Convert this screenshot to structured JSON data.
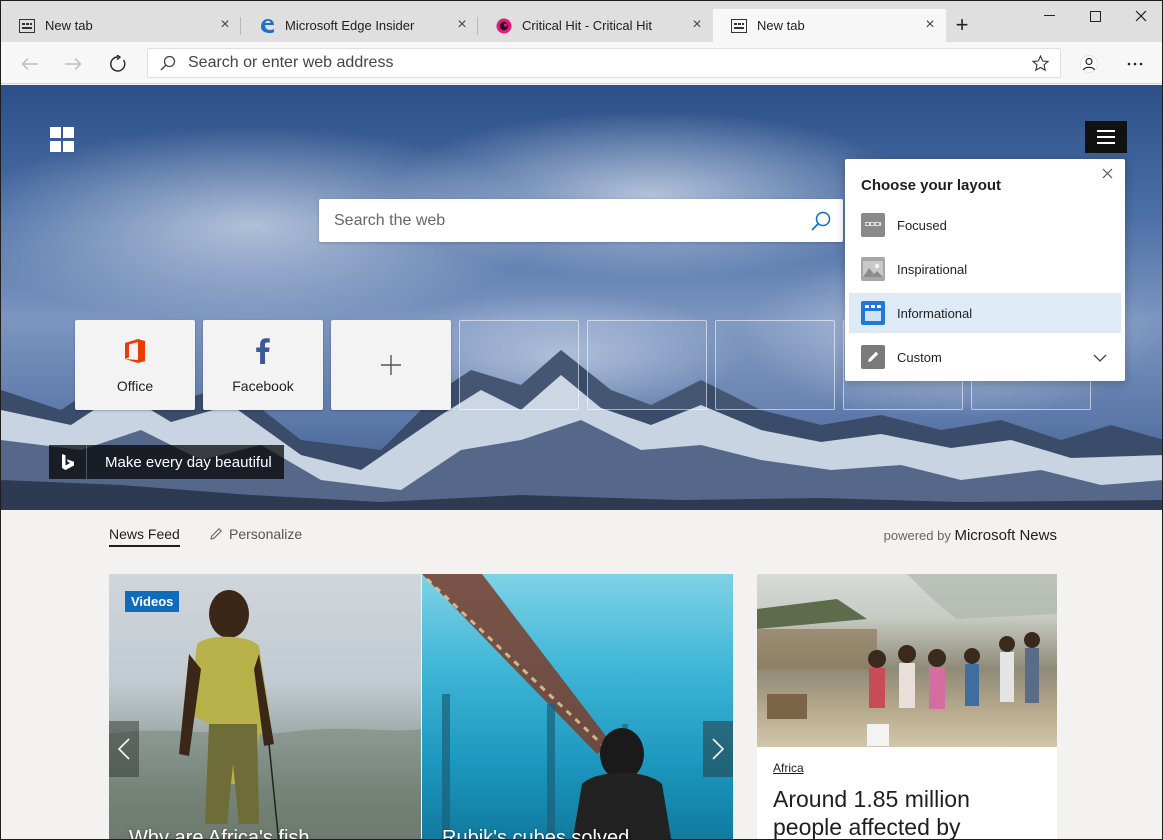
{
  "tabs": [
    {
      "title": "New tab",
      "icon": "newtab-icon"
    },
    {
      "title": "Microsoft Edge Insider",
      "icon": "edge-icon"
    },
    {
      "title": "Critical Hit - Critical Hit",
      "icon": "criticalhit-icon"
    },
    {
      "title": "New tab",
      "icon": "newtab-icon",
      "active": true
    }
  ],
  "address_bar": {
    "placeholder": "Search or enter web address"
  },
  "hero": {
    "search_placeholder": "Search the web",
    "bing_caption": "Make every day beautiful"
  },
  "quick_links": [
    {
      "label": "Office",
      "icon": "office-icon",
      "color": "#eb3c00"
    },
    {
      "label": "Facebook",
      "icon": "facebook-icon",
      "color": "#3b5998"
    },
    {
      "label": "",
      "icon": "add-icon"
    }
  ],
  "layout_panel": {
    "title": "Choose your layout",
    "options": [
      {
        "label": "Focused",
        "icon": "focused-layout-icon"
      },
      {
        "label": "Inspirational",
        "icon": "inspirational-layout-icon"
      },
      {
        "label": "Informational",
        "icon": "informational-layout-icon",
        "selected": true
      },
      {
        "label": "Custom",
        "icon": "custom-layout-icon"
      }
    ]
  },
  "news": {
    "tabs": [
      "News Feed",
      "Personalize"
    ],
    "powered_by_prefix": "powered by",
    "powered_by_brand": "Microsoft News",
    "cards": [
      {
        "badge": "Videos",
        "title": "Why are Africa's fish"
      },
      {
        "title": "Rubik's cubes solved"
      },
      {
        "category": "Africa",
        "headline": "Around 1.85 million people affected by"
      }
    ]
  },
  "colors": {
    "accent": "#0f6cbd",
    "selected_bg": "#dfeaf7"
  }
}
